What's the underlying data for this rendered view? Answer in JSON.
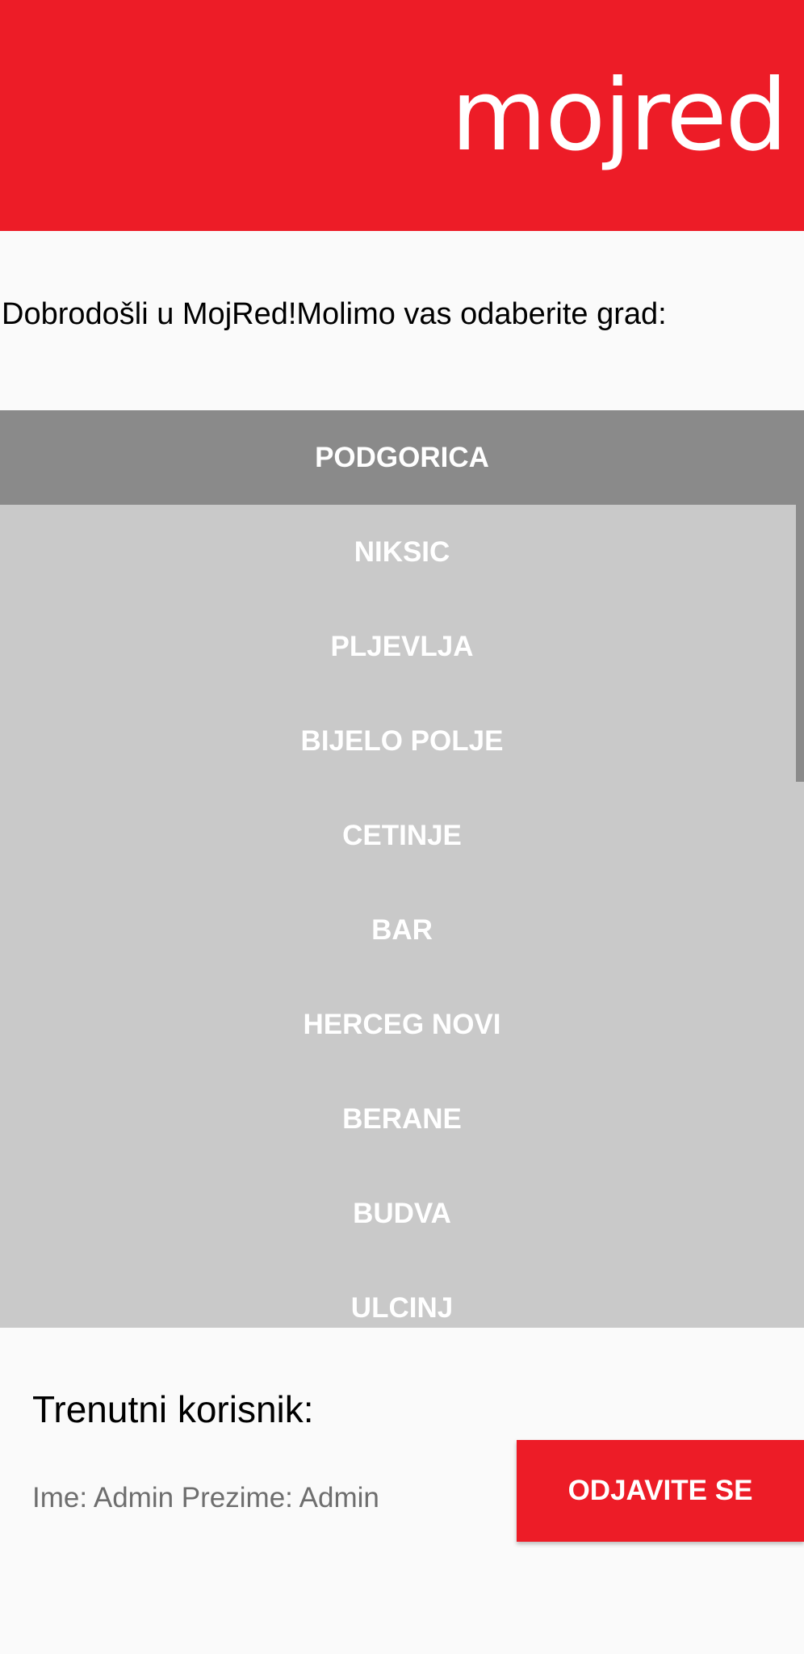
{
  "header": {
    "logo_text": "mojred",
    "brand_color": "#ed1c27"
  },
  "welcome_text": "Dobrodošli u MojRed!Molimo vas odaberite grad:",
  "cities": [
    {
      "label": "PODGORICA",
      "selected": true
    },
    {
      "label": "NIKSIC",
      "selected": false
    },
    {
      "label": "PLJEVLJA",
      "selected": false
    },
    {
      "label": "BIJELO POLJE",
      "selected": false
    },
    {
      "label": "CETINJE",
      "selected": false
    },
    {
      "label": "BAR",
      "selected": false
    },
    {
      "label": "HERCEG NOVI",
      "selected": false
    },
    {
      "label": "BERANE",
      "selected": false
    },
    {
      "label": "BUDVA",
      "selected": false
    },
    {
      "label": "ULCINJ",
      "selected": false
    }
  ],
  "user": {
    "title": "Trenutni korisnik:",
    "info": "Ime: Admin Prezime: Admin"
  },
  "logout_label": "ODJAVITE SE"
}
